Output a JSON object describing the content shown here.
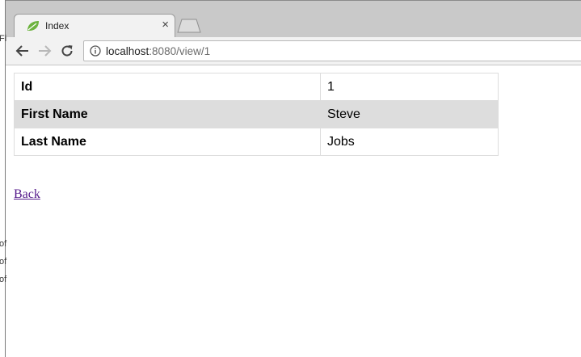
{
  "browser": {
    "tab_title": "Index",
    "tab_close": "×",
    "url_host": "localhost",
    "url_rest": ":8080/view/1"
  },
  "details": {
    "rows": [
      {
        "label": "Id",
        "value": "1"
      },
      {
        "label": "First Name",
        "value": "Steve"
      },
      {
        "label": "Last Name",
        "value": "Jobs"
      }
    ]
  },
  "back_link": "Back",
  "colors": {
    "row_shade": "#dddddd",
    "visited_link": "#551a8b",
    "favicon": "#6db33f"
  }
}
